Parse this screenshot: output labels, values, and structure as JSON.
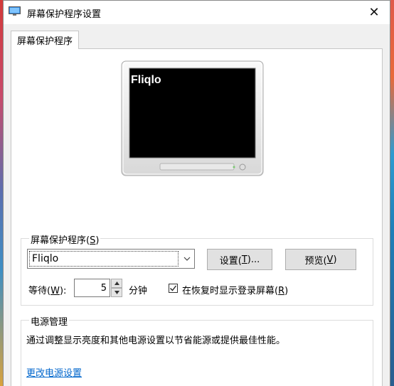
{
  "window": {
    "title": "屏幕保护程序设置",
    "close_symbol": "✕"
  },
  "tab": {
    "label": "屏幕保护程序"
  },
  "preview": {
    "screen_text": "Fliqlo"
  },
  "screensaver_group": {
    "label_prefix": "屏幕保护程序(",
    "label_key": "S",
    "label_suffix": ")",
    "selected": "Fliqlo",
    "settings_prefix": "设置(",
    "settings_key": "T",
    "settings_suffix": ")...",
    "preview_prefix": "预览(",
    "preview_key": "V",
    "preview_suffix": ")",
    "wait_prefix": "等待(",
    "wait_key": "W",
    "wait_suffix": "):",
    "wait_value": "5",
    "minutes_label": "分钟",
    "resume_checked": true,
    "resume_prefix": "在恢复时显示登录屏幕(",
    "resume_key": "R",
    "resume_suffix": ")"
  },
  "power_group": {
    "label": "电源管理",
    "description": "通过调整显示亮度和其他电源设置以节省能源或提供最佳性能。",
    "link": "更改电源设置"
  },
  "icons": [
    "monitor-app-icon",
    "close-icon",
    "chevron-down-icon",
    "spin-up-icon",
    "spin-down-icon",
    "checkmark-icon"
  ]
}
